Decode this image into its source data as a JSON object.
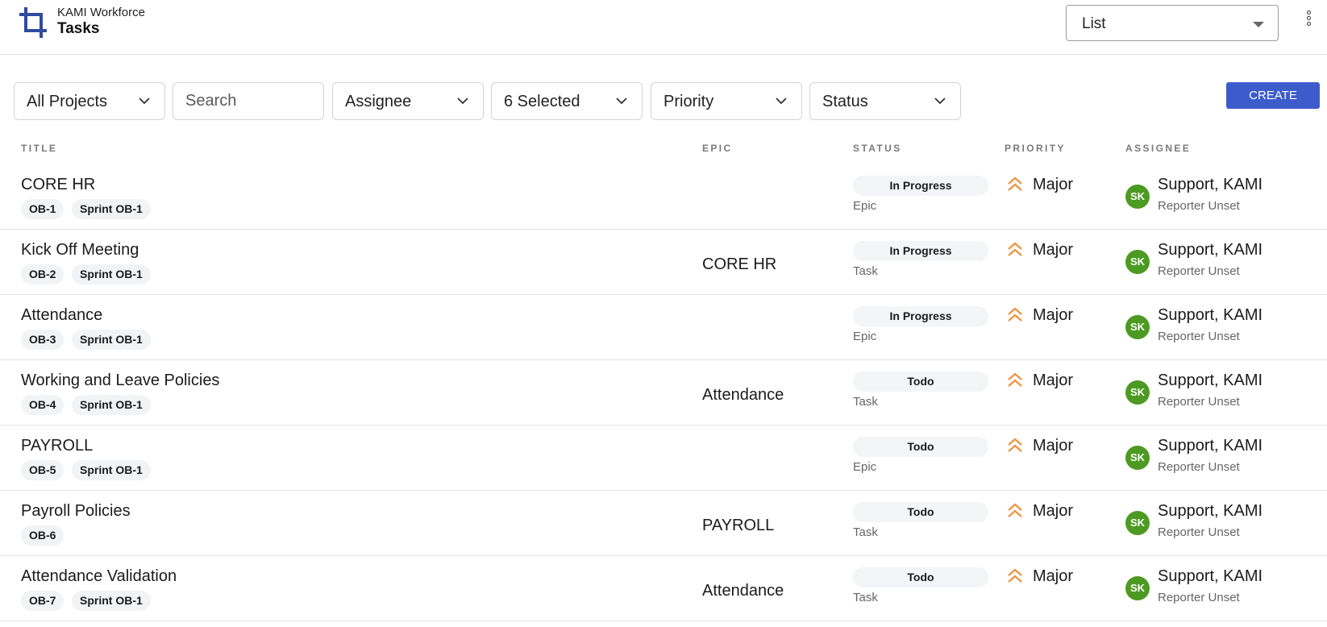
{
  "header": {
    "app_name": "KAMI Workforce",
    "page_title": "Tasks",
    "view_select": {
      "value": "List"
    }
  },
  "filters": {
    "project": "All Projects",
    "search_placeholder": "Search",
    "assignee": "Assignee",
    "type_selection": "6 Selected",
    "priority": "Priority",
    "status": "Status"
  },
  "create_button": "CREATE",
  "columns": {
    "title": "TITLE",
    "epic": "EPIC",
    "status": "STATUS",
    "priority": "PRIORITY",
    "assignee": "ASSIGNEE"
  },
  "rows": [
    {
      "title": "CORE HR",
      "key": "OB-1",
      "sprint": "Sprint OB-1",
      "epic": "",
      "status": "In Progress",
      "type": "Epic",
      "priority": "Major",
      "assignee_initials": "SK",
      "assignee": "Support, KAMI",
      "reporter": "Reporter Unset"
    },
    {
      "title": "Kick Off Meeting",
      "key": "OB-2",
      "sprint": "Sprint OB-1",
      "epic": "CORE HR",
      "status": "In Progress",
      "type": "Task",
      "priority": "Major",
      "assignee_initials": "SK",
      "assignee": "Support, KAMI",
      "reporter": "Reporter Unset"
    },
    {
      "title": "Attendance",
      "key": "OB-3",
      "sprint": "Sprint OB-1",
      "epic": "",
      "status": "In Progress",
      "type": "Epic",
      "priority": "Major",
      "assignee_initials": "SK",
      "assignee": "Support, KAMI",
      "reporter": "Reporter Unset"
    },
    {
      "title": "Working and Leave Policies",
      "key": "OB-4",
      "sprint": "Sprint OB-1",
      "epic": "Attendance",
      "status": "Todo",
      "type": "Task",
      "priority": "Major",
      "assignee_initials": "SK",
      "assignee": "Support, KAMI",
      "reporter": "Reporter Unset"
    },
    {
      "title": "PAYROLL",
      "key": "OB-5",
      "sprint": "Sprint OB-1",
      "epic": "",
      "status": "Todo",
      "type": "Epic",
      "priority": "Major",
      "assignee_initials": "SK",
      "assignee": "Support, KAMI",
      "reporter": "Reporter Unset"
    },
    {
      "title": "Payroll Policies",
      "key": "OB-6",
      "sprint": "",
      "epic": "PAYROLL",
      "status": "Todo",
      "type": "Task",
      "priority": "Major",
      "assignee_initials": "SK",
      "assignee": "Support, KAMI",
      "reporter": "Reporter Unset"
    },
    {
      "title": "Attendance Validation",
      "key": "OB-7",
      "sprint": "Sprint OB-1",
      "epic": "Attendance",
      "status": "Todo",
      "type": "Task",
      "priority": "Major",
      "assignee_initials": "SK",
      "assignee": "Support, KAMI",
      "reporter": "Reporter Unset"
    }
  ],
  "colors": {
    "brand": "#2f4b9e",
    "create_button": "#3d5ccc",
    "priority_major": "#f0923a",
    "avatar": "#4c9a22"
  },
  "icons": {
    "logo": "crop-square-logo-icon",
    "view_dropdown": "caret-down-icon",
    "more": "more-vert-icon",
    "filter_dropdown": "chevron-down-icon",
    "priority": "double-chevron-up-icon"
  }
}
